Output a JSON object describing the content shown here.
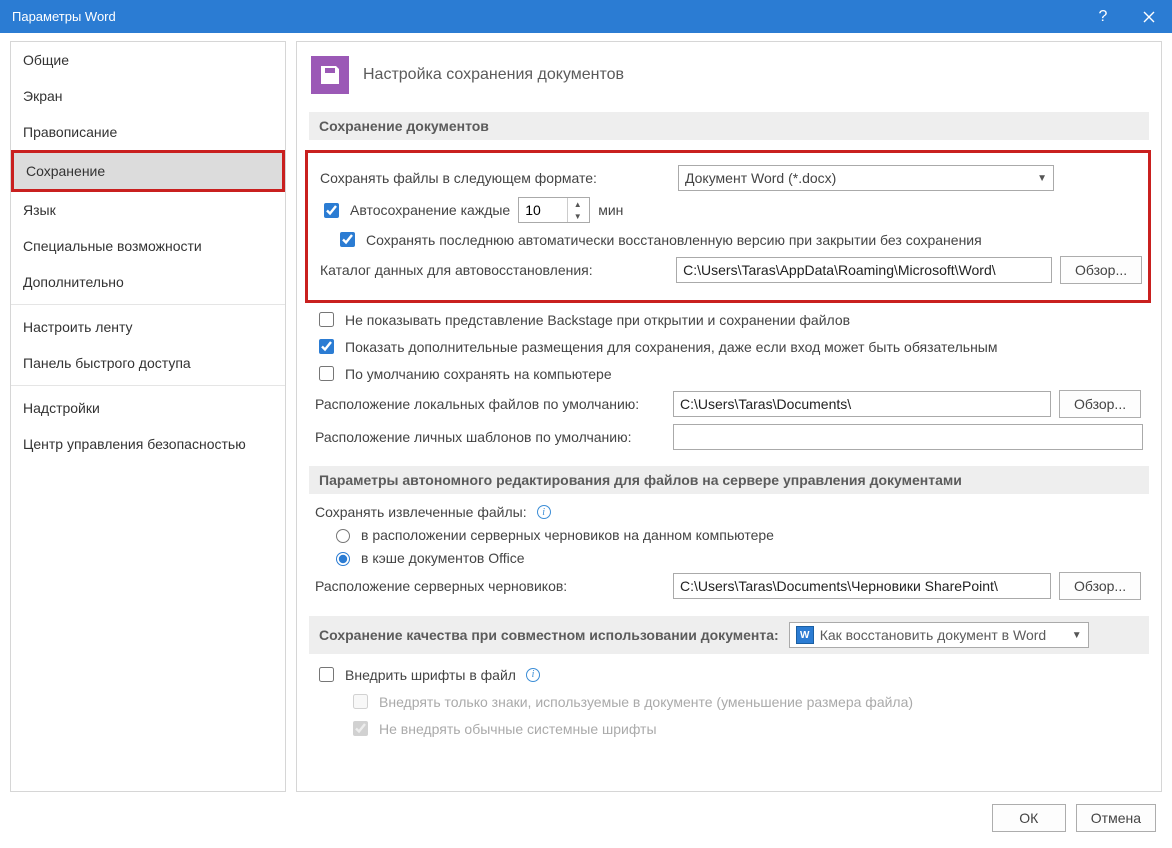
{
  "titlebar": {
    "title": "Параметры Word"
  },
  "sidebar": {
    "items": [
      "Общие",
      "Экран",
      "Правописание",
      "Сохранение",
      "Язык",
      "Специальные возможности",
      "Дополнительно",
      "Настроить ленту",
      "Панель быстрого доступа",
      "Надстройки",
      "Центр управления безопасностью"
    ],
    "active_index": 3
  },
  "header": {
    "title": "Настройка сохранения документов"
  },
  "section1": {
    "title": "Сохранение документов",
    "format_label": "Сохранять файлы в следующем формате:",
    "format_value": "Документ Word (*.docx)",
    "autosave_label": "Автосохранение каждые",
    "autosave_value": "10",
    "autosave_unit": "мин",
    "keep_last_label": "Сохранять последнюю автоматически восстановленную версию при закрытии без сохранения",
    "autorecover_dir_label": "Каталог данных для автовосстановления:",
    "autorecover_dir_value": "C:\\Users\\Taras\\AppData\\Roaming\\Microsoft\\Word\\",
    "browse": "Обзор...",
    "no_backstage_label": "Не показывать представление Backstage при открытии и сохранении файлов",
    "show_additional_label": "Показать дополнительные размещения для сохранения, даже если вход может быть обязательным",
    "default_pc_label": "По умолчанию сохранять на компьютере",
    "local_default_label": "Расположение локальных файлов по умолчанию:",
    "local_default_value": "C:\\Users\\Taras\\Documents\\",
    "templates_label": "Расположение личных шаблонов по умолчанию:",
    "templates_value": ""
  },
  "section2": {
    "title": "Параметры автономного редактирования для файлов на сервере управления документами",
    "save_checked_label": "Сохранять извлеченные файлы:",
    "radio1": "в расположении серверных черновиков на данном компьютере",
    "radio2": "в кэше документов Office",
    "drafts_label": "Расположение серверных черновиков:",
    "drafts_value": "C:\\Users\\Taras\\Documents\\Черновики SharePoint\\",
    "browse": "Обзор..."
  },
  "section3": {
    "title": "Сохранение качества при совместном использовании документа:",
    "doc_selector": "Как восстановить документ в Word",
    "embed_label": "Внедрить шрифты в файл",
    "embed_sub1": "Внедрять только знаки, используемые в документе (уменьшение размера файла)",
    "embed_sub2": "Не внедрять обычные системные шрифты"
  },
  "footer": {
    "ok": "ОК",
    "cancel": "Отмена"
  }
}
